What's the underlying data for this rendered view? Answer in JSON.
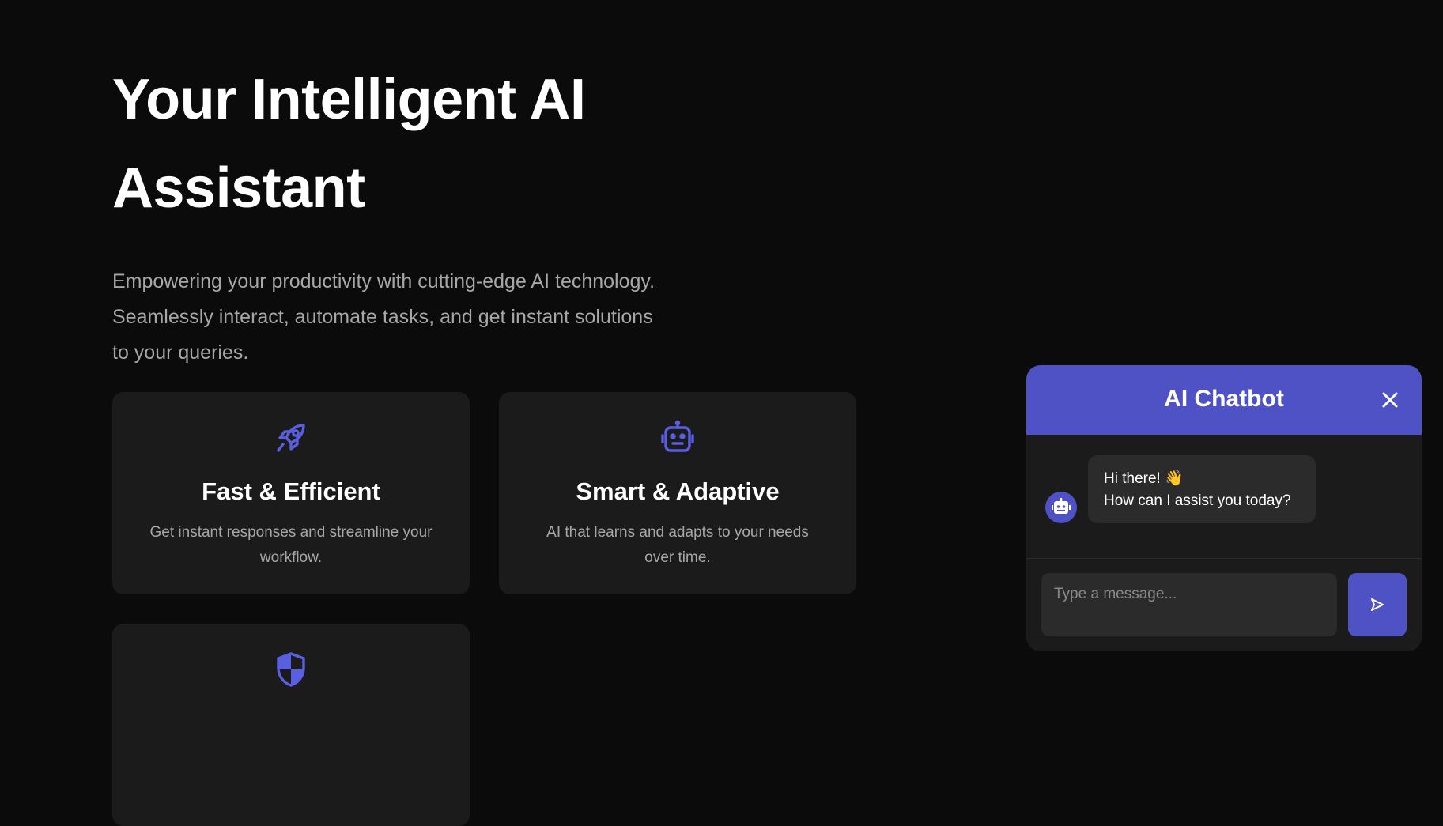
{
  "hero": {
    "title_line1": "Your Intelligent AI",
    "title_line2": "Assistant",
    "subtitle_line1": "Empowering your productivity with cutting-edge AI technology.",
    "subtitle_line2": "Seamlessly interact, automate tasks, and get instant solutions",
    "subtitle_line3": "to your queries."
  },
  "features": [
    {
      "icon": "rocket-icon",
      "title": "Fast & Efficient",
      "text": "Get instant responses and streamline your workflow."
    },
    {
      "icon": "robot-icon",
      "title": "Smart & Adaptive",
      "text": "AI that learns and adapts to your needs over time."
    },
    {
      "icon": "shield-icon"
    }
  ],
  "chatbot": {
    "title": "AI Chatbot",
    "close_icon": "close-icon",
    "messages": [
      {
        "sender": "bot",
        "line1": "Hi there! 👋",
        "line2": "How can I assist you today?"
      }
    ],
    "input_placeholder": "Type a message...",
    "send_icon": "send-icon"
  },
  "colors": {
    "accent": "#4f52c4",
    "background": "#0b0b0b",
    "card": "#1b1b1b"
  }
}
